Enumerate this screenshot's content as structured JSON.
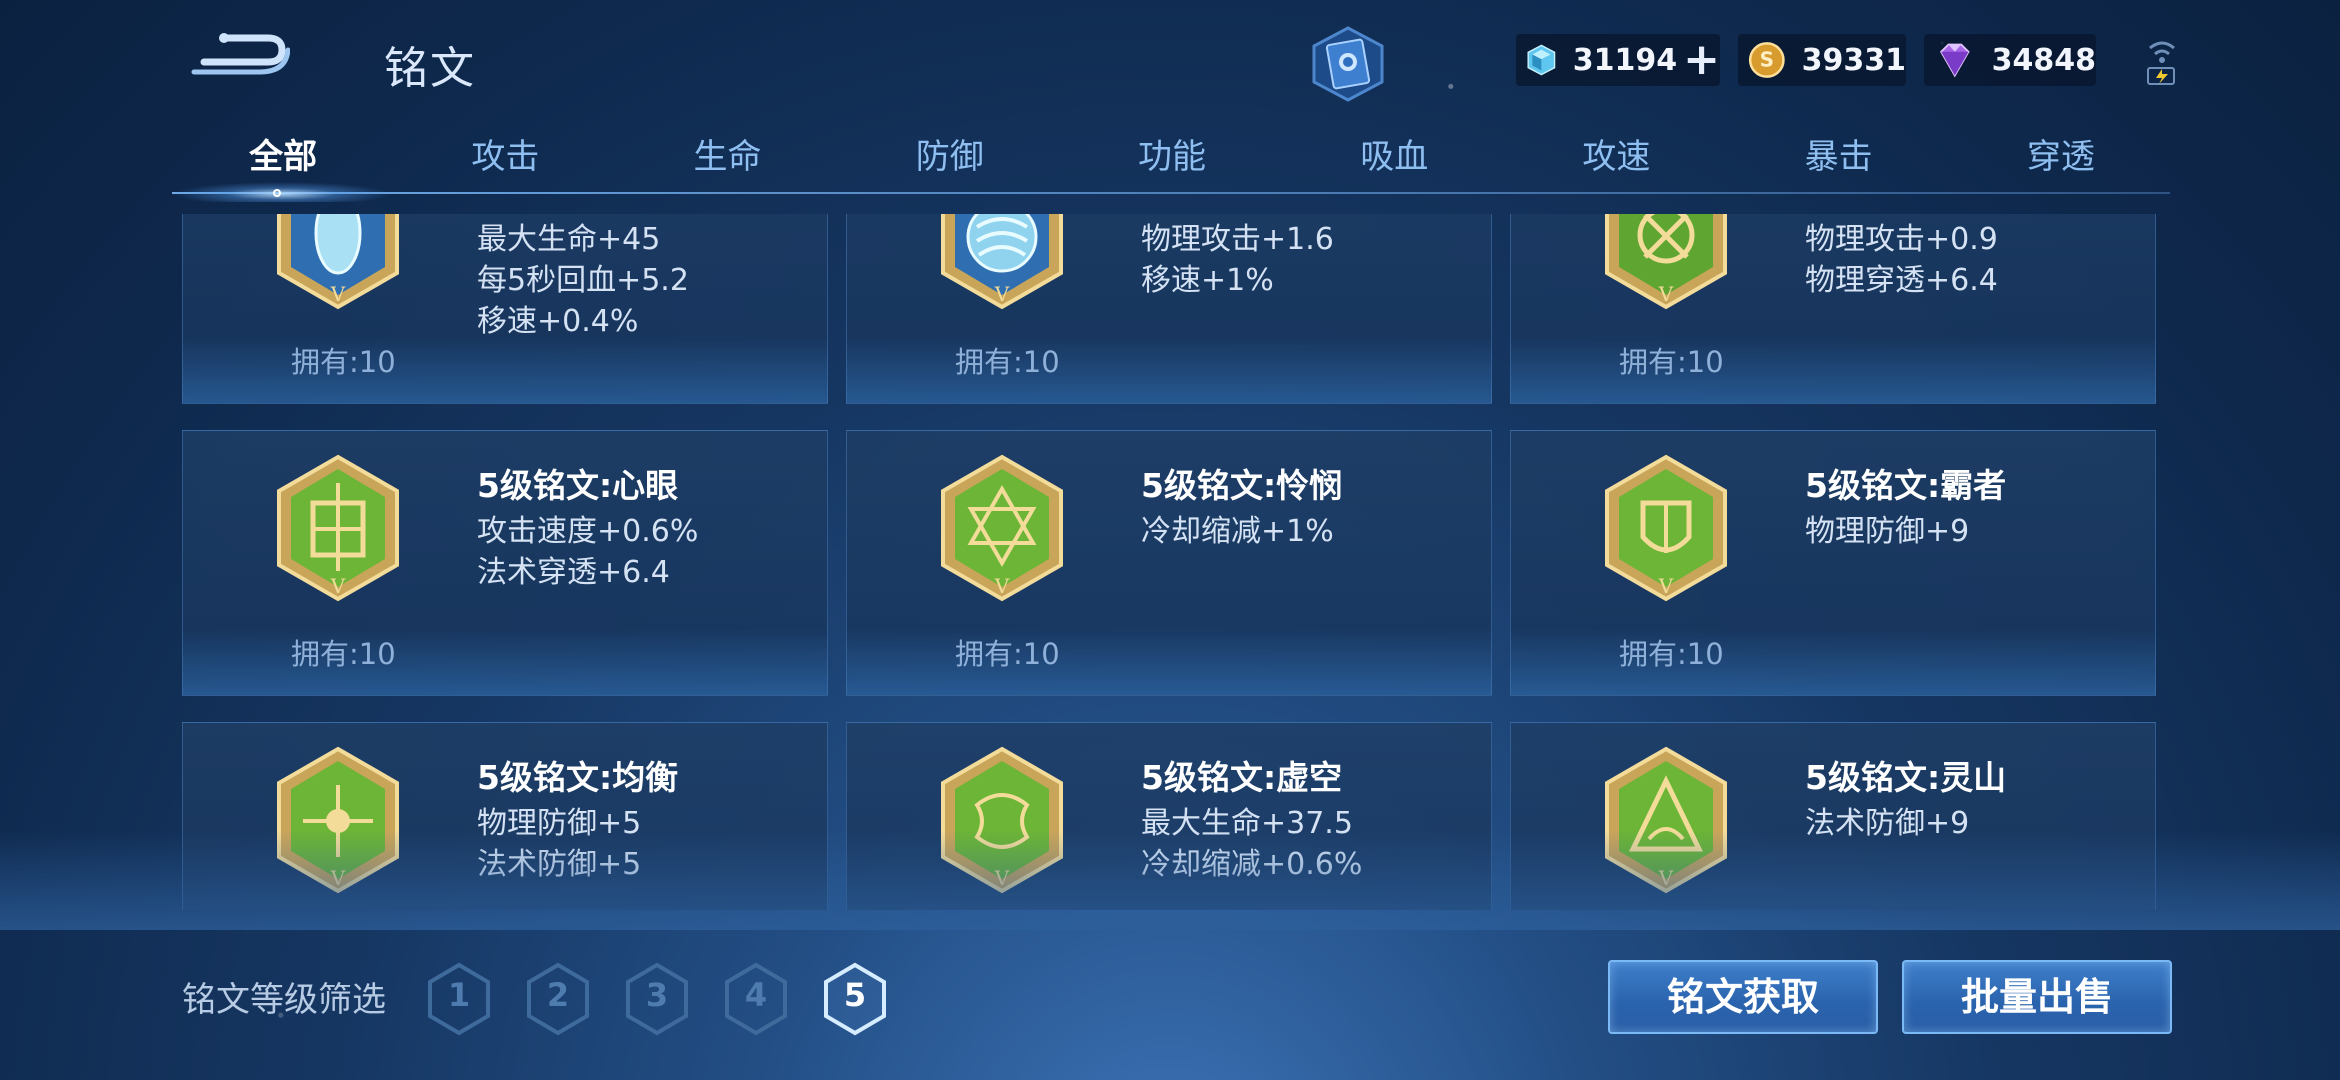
{
  "header": {
    "title": "铭文",
    "currencies": [
      {
        "icon": "crystal-icon",
        "value": "31194",
        "has_plus": true
      },
      {
        "icon": "gold-coin-icon",
        "value": "39331"
      },
      {
        "icon": "purple-diamond-icon",
        "value": "34848"
      }
    ]
  },
  "tabs": [
    "全部",
    "攻击",
    "生命",
    "防御",
    "功能",
    "吸血",
    "攻速",
    "暴击",
    "穿透"
  ],
  "active_tab": "全部",
  "cards": [
    {
      "name": "",
      "attrs": [
        "最大生命+45",
        "每5秒回血+5.2",
        "移速+0.4%"
      ],
      "owned": "拥有:10",
      "icon": "blue-teardrop-rune-icon"
    },
    {
      "name": "",
      "attrs": [
        "物理攻击+1.6",
        "移速+1%"
      ],
      "owned": "拥有:10",
      "icon": "blue-swirl-rune-icon"
    },
    {
      "name": "",
      "attrs": [
        "物理攻击+0.9",
        "物理穿透+6.4"
      ],
      "owned": "拥有:10",
      "icon": "green-knot-rune-icon"
    },
    {
      "name": "5级铭文:心眼",
      "attrs": [
        "攻击速度+0.6%",
        "法术穿透+6.4"
      ],
      "owned": "拥有:10",
      "icon": "green-rune-xinyan-icon"
    },
    {
      "name": "5级铭文:怜悯",
      "attrs": [
        "冷却缩减+1%"
      ],
      "owned": "拥有:10",
      "icon": "green-rune-lianmin-icon"
    },
    {
      "name": "5级铭文:霸者",
      "attrs": [
        "物理防御+9"
      ],
      "owned": "拥有:10",
      "icon": "green-rune-bazhe-icon"
    },
    {
      "name": "5级铭文:均衡",
      "attrs": [
        "物理防御+5",
        "法术防御+5"
      ],
      "owned": "",
      "icon": "green-rune-junheng-icon"
    },
    {
      "name": "5级铭文:虚空",
      "attrs": [
        "最大生命+37.5",
        "冷却缩减+0.6%"
      ],
      "owned": "",
      "icon": "green-rune-xukong-icon"
    },
    {
      "name": "5级铭文:灵山",
      "attrs": [
        "法术防御+9"
      ],
      "owned": "",
      "icon": "green-rune-lingshan-icon"
    }
  ],
  "footer": {
    "filter_label": "铭文等级筛选",
    "levels": [
      "1",
      "2",
      "3",
      "4",
      "5"
    ],
    "selected_level": "5",
    "acquire_button": "铭文获取",
    "sell_button": "批量出售"
  }
}
